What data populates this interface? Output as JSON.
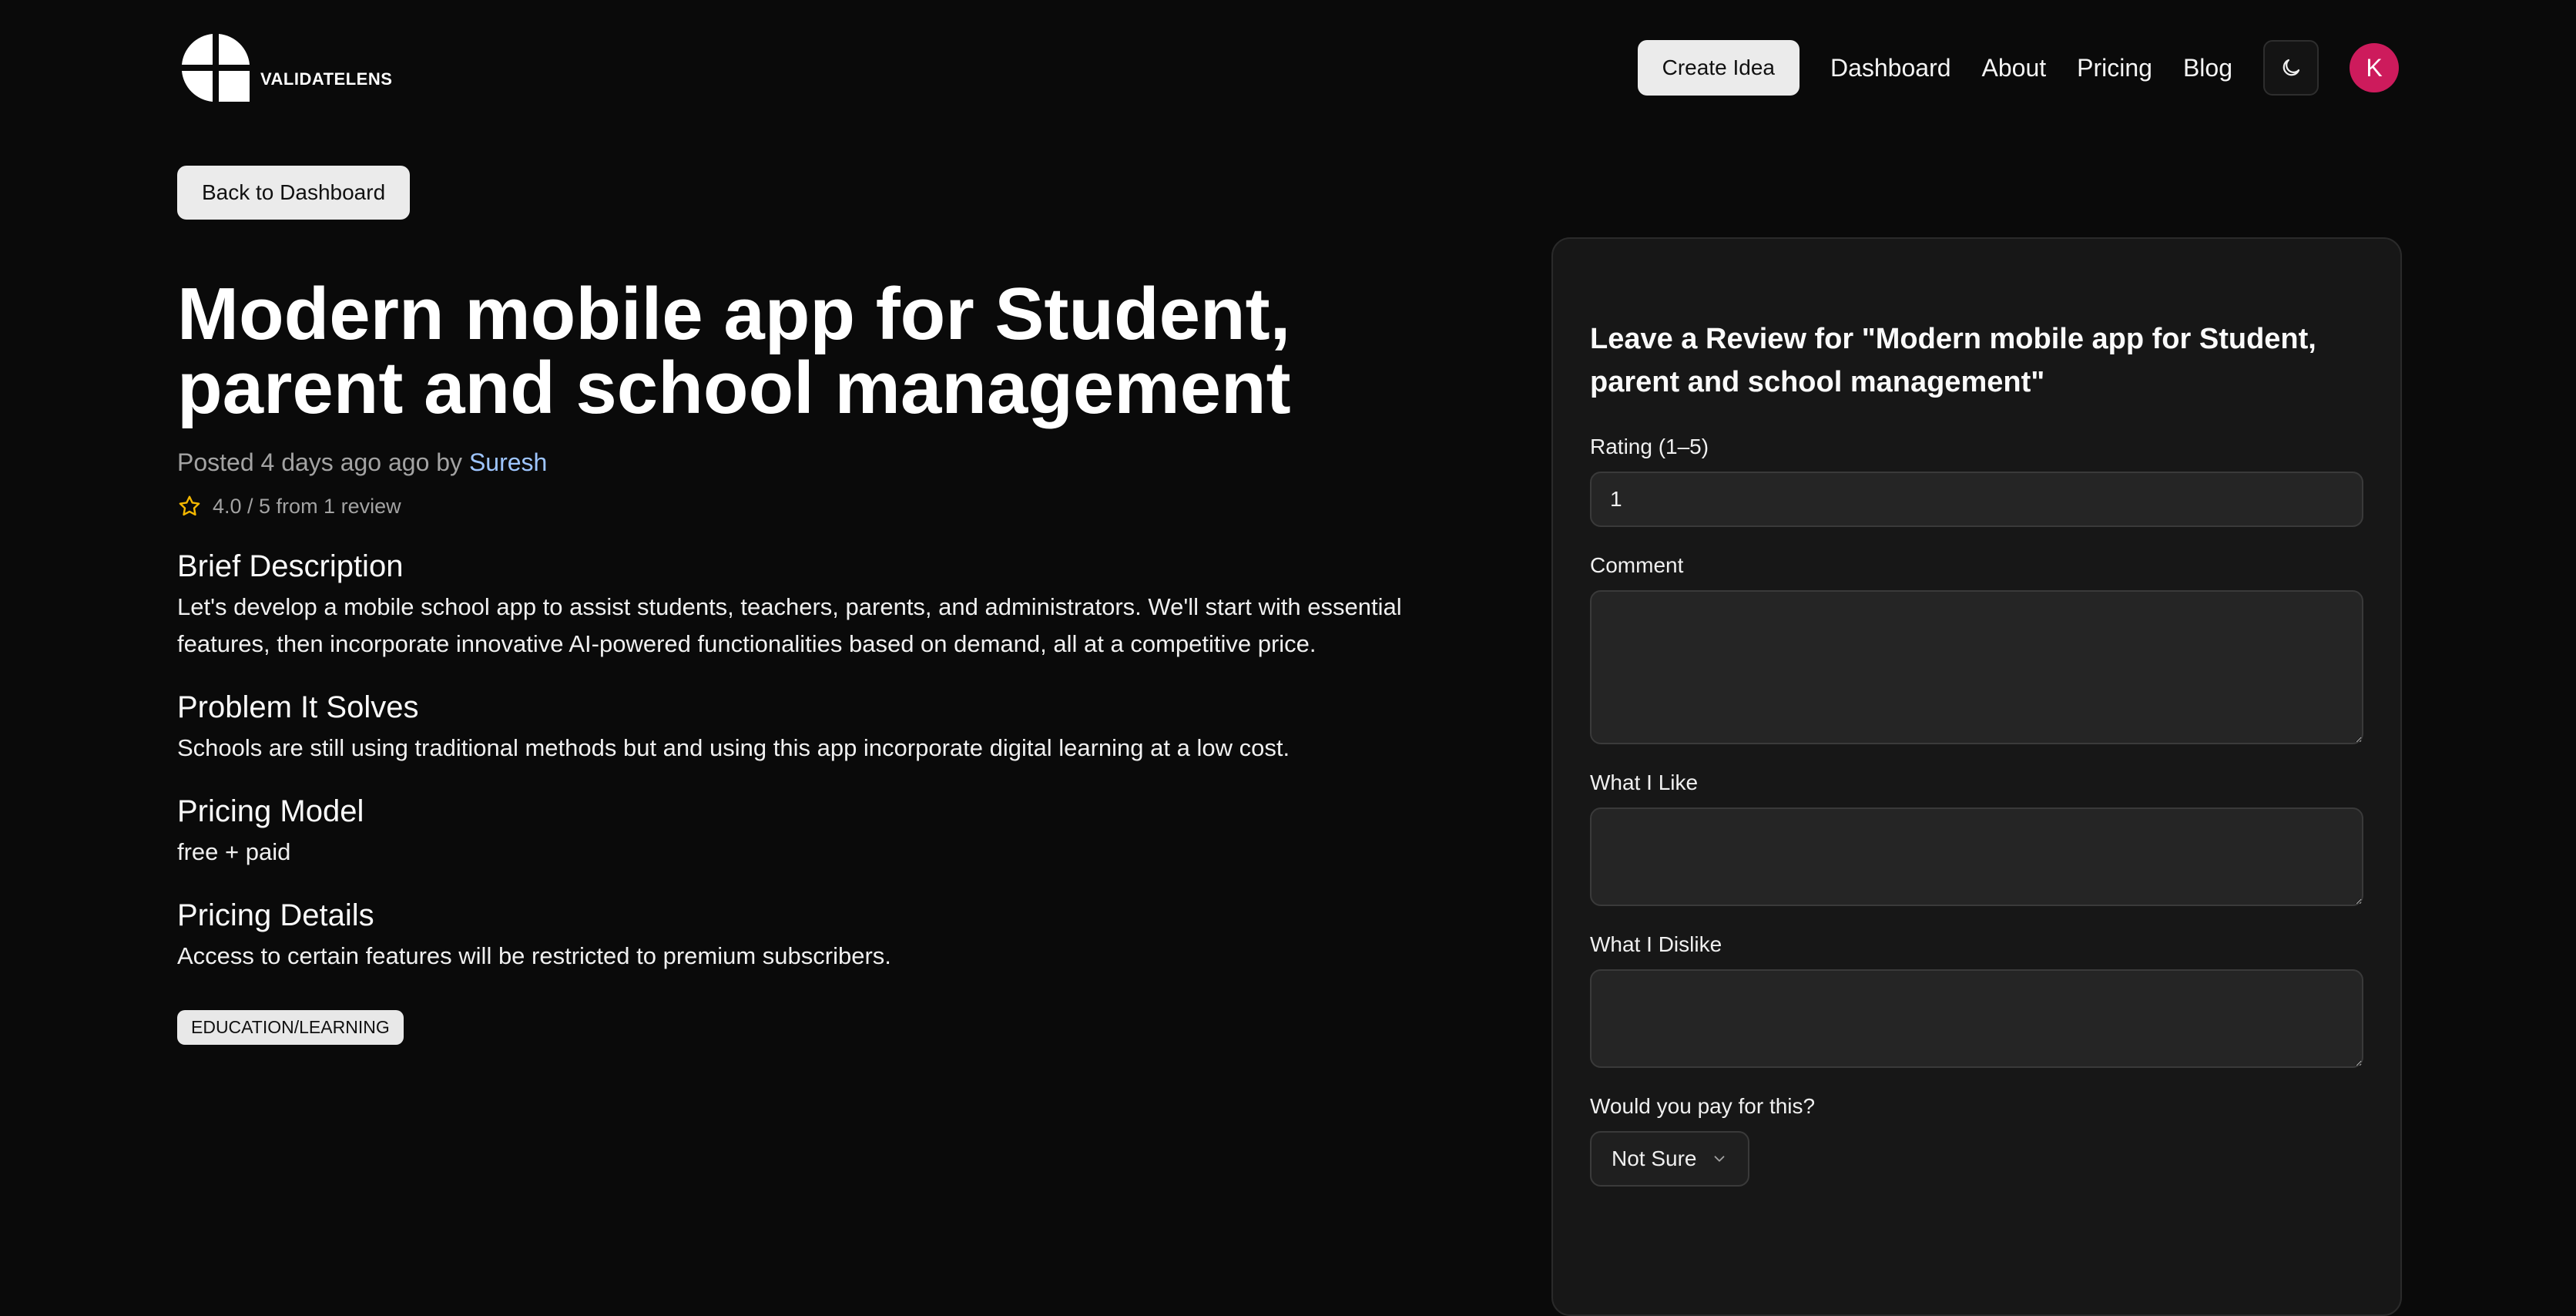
{
  "brand": {
    "name": "VALIDATELENS"
  },
  "nav": {
    "create_label": "Create Idea",
    "links": [
      "Dashboard",
      "About",
      "Pricing",
      "Blog"
    ],
    "theme_icon": "moon-icon",
    "avatar_initial": "K"
  },
  "back_label": "Back to Dashboard",
  "idea": {
    "title": "Modern mobile app for Student, parent and school management",
    "posted_prefix": "Posted 4 days ago ago by ",
    "author": "Suresh",
    "rating_text": "4.0 / 5 from 1 review",
    "sections": [
      {
        "heading": "Brief Description",
        "body": "Let's develop a mobile school app to assist students, teachers, parents, and administrators. We'll start with essential features, then incorporate innovative AI-powered functionalities based on demand, all at a competitive price."
      },
      {
        "heading": "Problem It Solves",
        "body": "Schools are still using traditional methods but and using this app incorporate digital learning at a low cost."
      },
      {
        "heading": "Pricing Model",
        "body": "free + paid"
      },
      {
        "heading": "Pricing Details",
        "body": "Access to certain features will be restricted to premium subscribers."
      }
    ],
    "tag": "EDUCATION/LEARNING"
  },
  "review": {
    "heading": "Leave a Review for \"Modern mobile app for Student, parent and school management\"",
    "rating_label": "Rating (1–5)",
    "rating_value": "1",
    "comment_label": "Comment",
    "like_label": "What I Like",
    "dislike_label": "What I Dislike",
    "pay_label": "Would you pay for this?",
    "pay_value": "Not Sure"
  },
  "colors": {
    "background": "#0a0a0a",
    "card": "#171717",
    "accent_avatar": "#cd1b5c",
    "author_link": "#9ec5ff",
    "star": "#f5b800"
  }
}
